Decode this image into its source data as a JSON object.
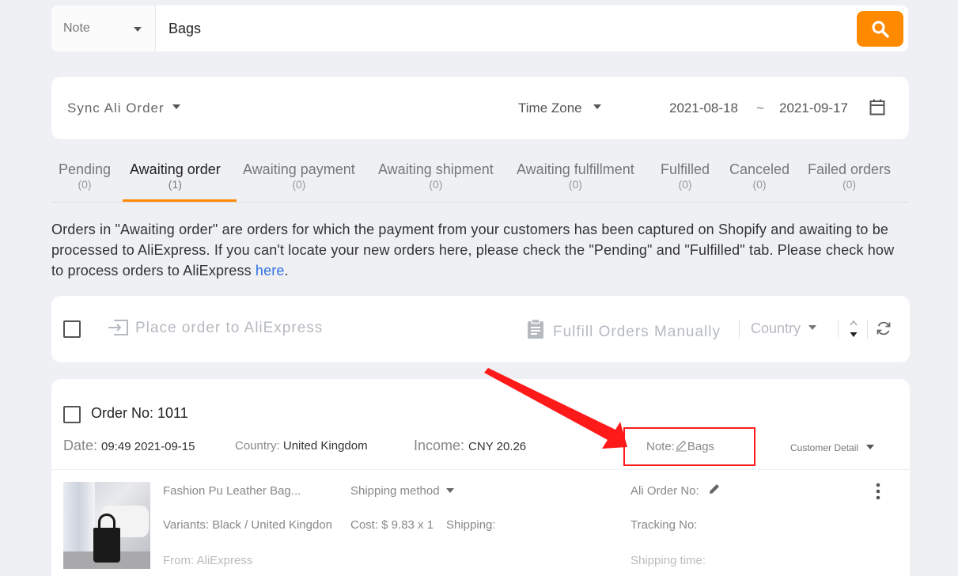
{
  "search": {
    "type_label": "Note",
    "value": "Bags"
  },
  "filter": {
    "sync_label": "Sync Ali Order",
    "timezone_label": "Time Zone",
    "date_from": "2021-08-18",
    "date_sep": "~",
    "date_to": "2021-09-17"
  },
  "tabs": [
    {
      "label": "Pending",
      "count": "(0)"
    },
    {
      "label": "Awaiting order",
      "count": "(1)"
    },
    {
      "label": "Awaiting payment",
      "count": "(0)"
    },
    {
      "label": "Awaiting shipment",
      "count": "(0)"
    },
    {
      "label": "Awaiting fulfillment",
      "count": "(0)"
    },
    {
      "label": "Fulfilled",
      "count": "(0)"
    },
    {
      "label": "Canceled",
      "count": "(0)"
    },
    {
      "label": "Failed orders",
      "count": "(0)"
    }
  ],
  "active_tab": "Awaiting order",
  "description": {
    "text": "Orders in \"Awaiting order\" are orders for which the payment from your customers has been captured on Shopify and awaiting to be processed to AliExpress. If you can't locate your new orders here, please check the \"Pending\" and \"Fulfilled\" tab. Please check how to process orders to AliExpress ",
    "link": "here",
    "end": "."
  },
  "actions": {
    "place_label": "Place order to AliExpress",
    "manual_label": "Fulfill Orders Manually",
    "country_label": "Country"
  },
  "order": {
    "number_label": "Order No: 1011",
    "date_key": "Date:",
    "date_val": "09:49 2021-09-15",
    "country_key": "Country:",
    "country_val": "United Kingdom",
    "income_key": "Income:",
    "income_val": "CNY 20.26",
    "note_key": "Note:",
    "note_val": "Bags",
    "customer_detail": "Customer Detail",
    "product": {
      "title": "Fashion Pu Leather Bag...",
      "variants": "Variants: Black / United Kingdon",
      "from": "From: AliExpress",
      "shipping_method": "Shipping method",
      "cost": "Cost: $ 9.83 x 1",
      "shipping": "Shipping:",
      "ali_order_no": "Ali Order No:",
      "tracking_no": "Tracking No:",
      "shipping_time": "Shipping time:"
    }
  },
  "colors": {
    "accent": "#ff8a00",
    "annotation": "#ff1a1a",
    "link": "#2f6fe0"
  }
}
